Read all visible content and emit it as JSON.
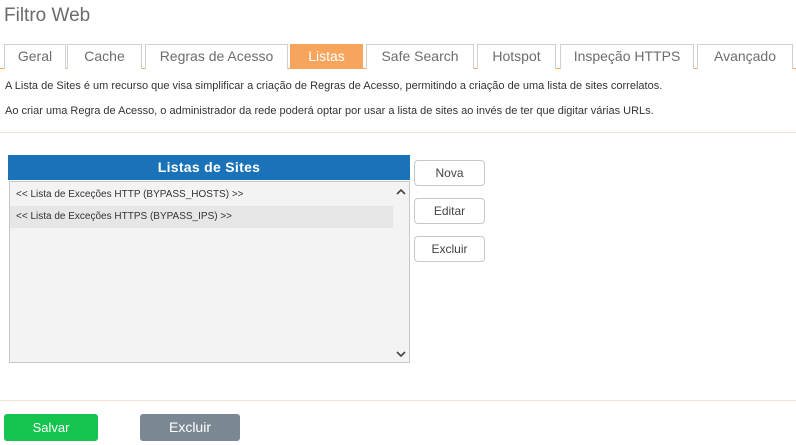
{
  "header": {
    "title": "Filtro Web"
  },
  "tabs": [
    {
      "label": "Geral",
      "active": false
    },
    {
      "label": "Cache",
      "active": false
    },
    {
      "label": "Regras de Acesso",
      "active": false
    },
    {
      "label": "Listas",
      "active": true
    },
    {
      "label": "Safe Search",
      "active": false
    },
    {
      "label": "Hotspot",
      "active": false
    },
    {
      "label": "Inspeção HTTPS",
      "active": false
    },
    {
      "label": "Avançado",
      "active": false
    }
  ],
  "description": {
    "line1": "A Lista de Sites é um recurso que visa simplificar a criação de Regras de Acesso, permitindo a criação de uma lista de sites correlatos.",
    "line2": "Ao criar uma Regra de Acesso, o administrador da rede poderá optar por usar a lista de sites ao invés de ter que digitar várias URLs."
  },
  "sites_list": {
    "header": "Listas de Sites",
    "items": [
      "<< Lista de Exceções HTTP (BYPASS_HOSTS) >>",
      "<< Lista de Exceções HTTPS (BYPASS_IPS) >>"
    ]
  },
  "side_actions": {
    "new_label": "Nova",
    "edit_label": "Editar",
    "delete_label": "Excluir"
  },
  "footer": {
    "save_label": "Salvar",
    "delete_label": "Excluir"
  },
  "colors": {
    "accent": "#f7a55c",
    "list_header": "#1a72b8",
    "save": "#14c44e",
    "delete": "#7b8893"
  }
}
